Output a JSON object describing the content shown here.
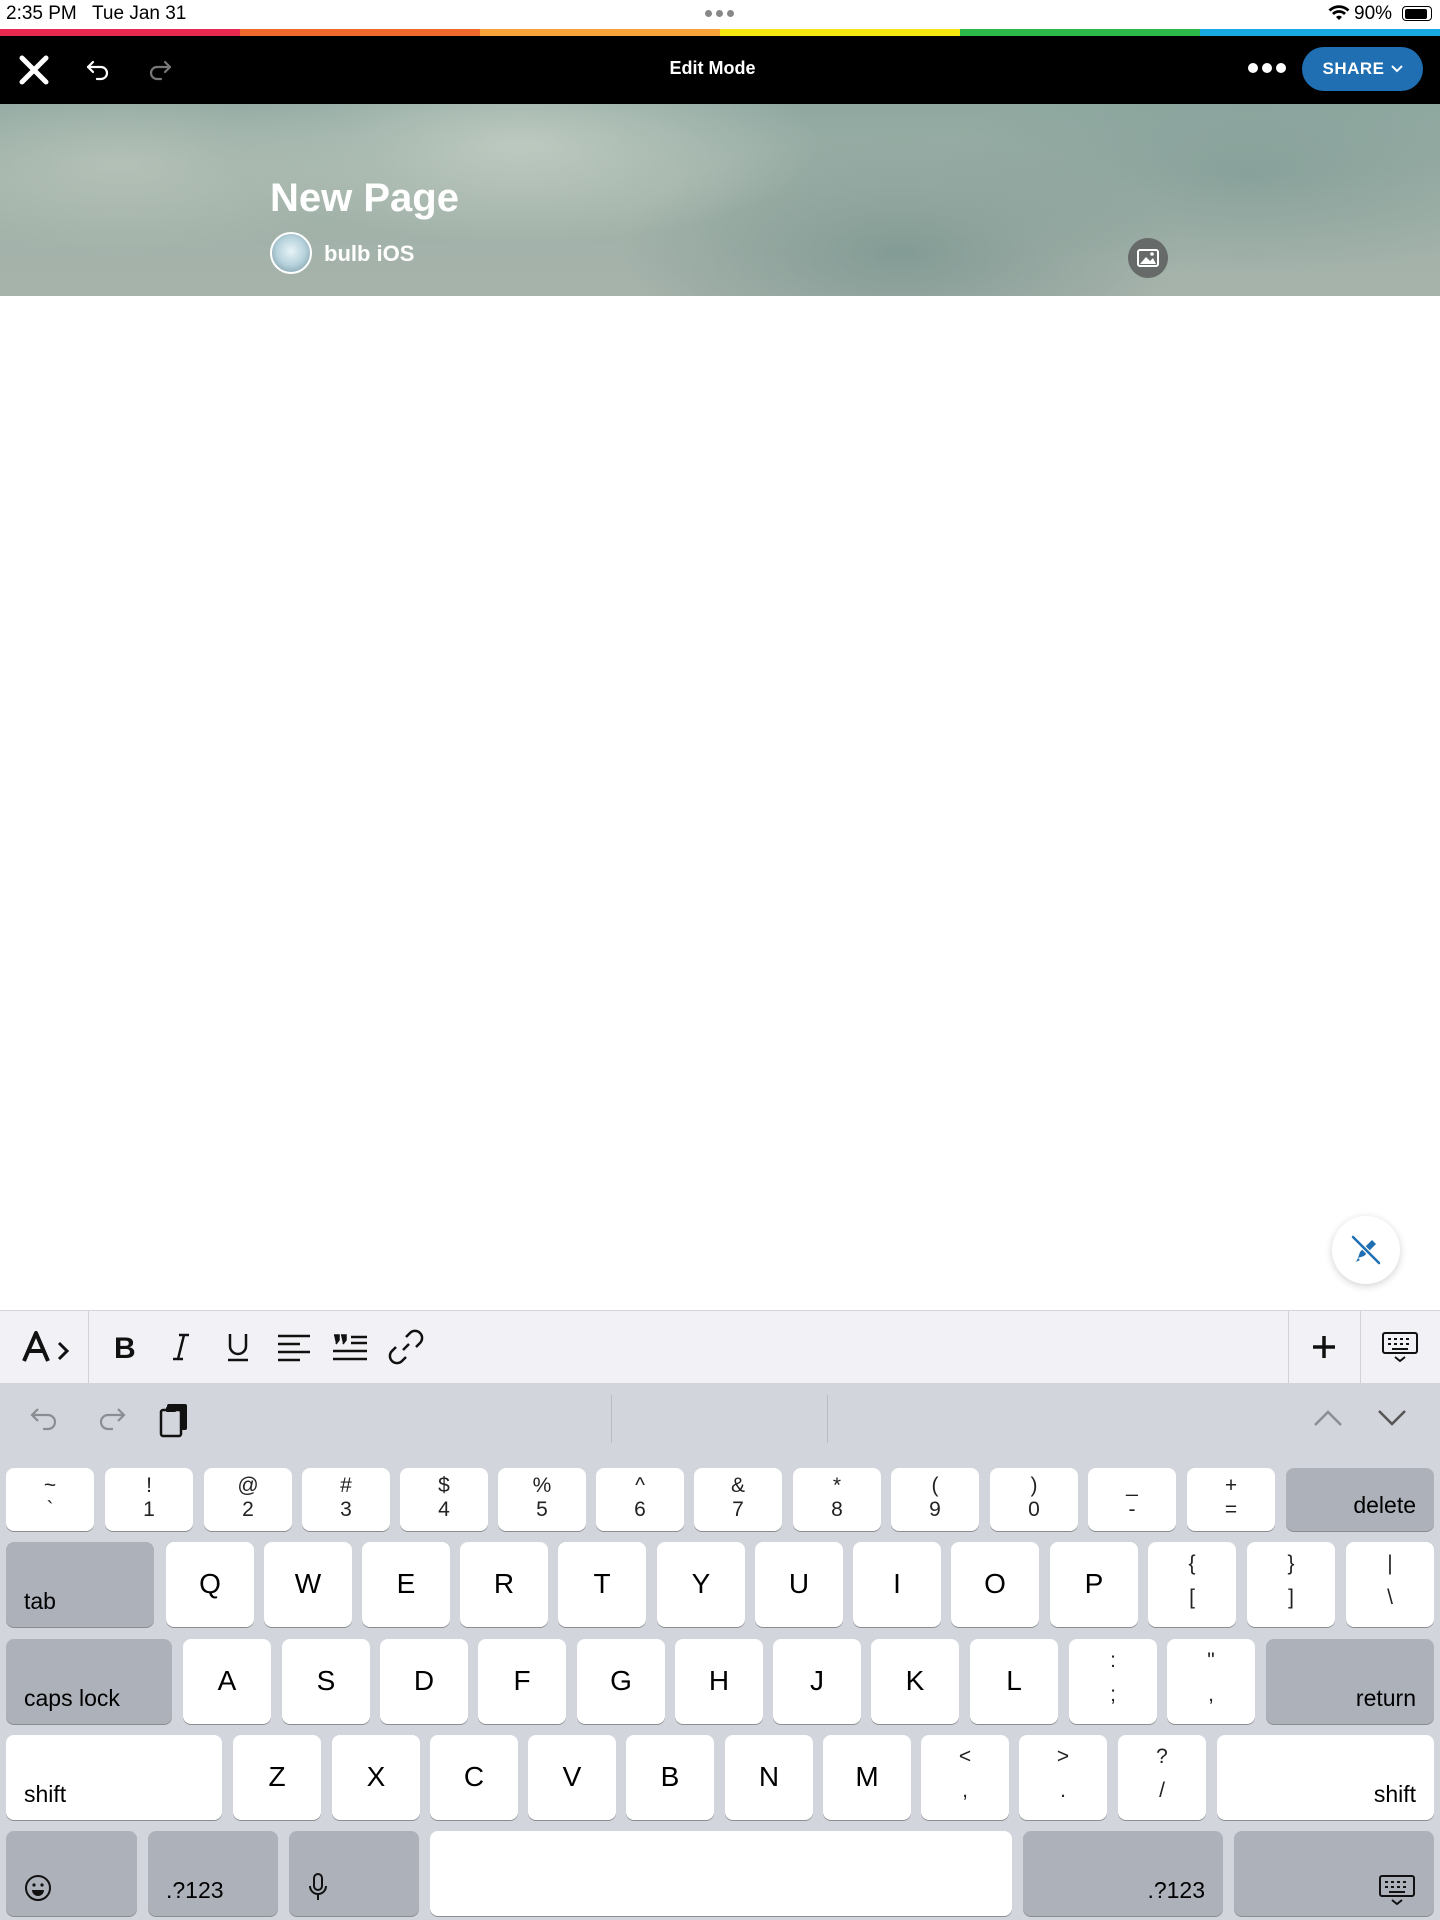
{
  "status_bar": {
    "time": "2:35 PM",
    "date": "Tue Jan 31",
    "battery": "90%"
  },
  "rainbow_colors": [
    "#e8294f",
    "#f26a2b",
    "#f5a33a",
    "#f6e60f",
    "#2db84a",
    "#19a9e1"
  ],
  "nav": {
    "title": "Edit Mode",
    "share_label": "SHARE",
    "accent": "#1f6fb2"
  },
  "header": {
    "page_title": "New Page",
    "author": "bulb iOS"
  },
  "keyboard": {
    "number_row": [
      {
        "top": "~",
        "bottom": "`"
      },
      {
        "top": "!",
        "bottom": "1"
      },
      {
        "top": "@",
        "bottom": "2"
      },
      {
        "top": "#",
        "bottom": "3"
      },
      {
        "top": "$",
        "bottom": "4"
      },
      {
        "top": "%",
        "bottom": "5"
      },
      {
        "top": "^",
        "bottom": "6"
      },
      {
        "top": "&",
        "bottom": "7"
      },
      {
        "top": "*",
        "bottom": "8"
      },
      {
        "top": "(",
        "bottom": "9"
      },
      {
        "top": ")",
        "bottom": "0"
      },
      {
        "top": "_",
        "bottom": "-"
      },
      {
        "top": "+",
        "bottom": "="
      }
    ],
    "delete": "delete",
    "tab": "tab",
    "q_row": [
      "Q",
      "W",
      "E",
      "R",
      "T",
      "Y",
      "U",
      "I",
      "O",
      "P"
    ],
    "q_row_symbols": [
      {
        "top": "{",
        "bottom": "["
      },
      {
        "top": "}",
        "bottom": "]"
      },
      {
        "top": "|",
        "bottom": "\\"
      }
    ],
    "caps_lock": "caps lock",
    "a_row": [
      "A",
      "S",
      "D",
      "F",
      "G",
      "H",
      "J",
      "K",
      "L"
    ],
    "a_row_symbols": [
      {
        "top": ":",
        "bottom": ";"
      },
      {
        "top": "\"",
        "bottom": ","
      }
    ],
    "return": "return",
    "shift": "shift",
    "z_row": [
      "Z",
      "X",
      "C",
      "V",
      "B",
      "N",
      "M"
    ],
    "z_row_symbols": [
      {
        "top": "<",
        "bottom": ","
      },
      {
        "top": ">",
        "bottom": "."
      },
      {
        "top": "?",
        "bottom": "/"
      }
    ],
    "numbers_key": ".?123"
  }
}
